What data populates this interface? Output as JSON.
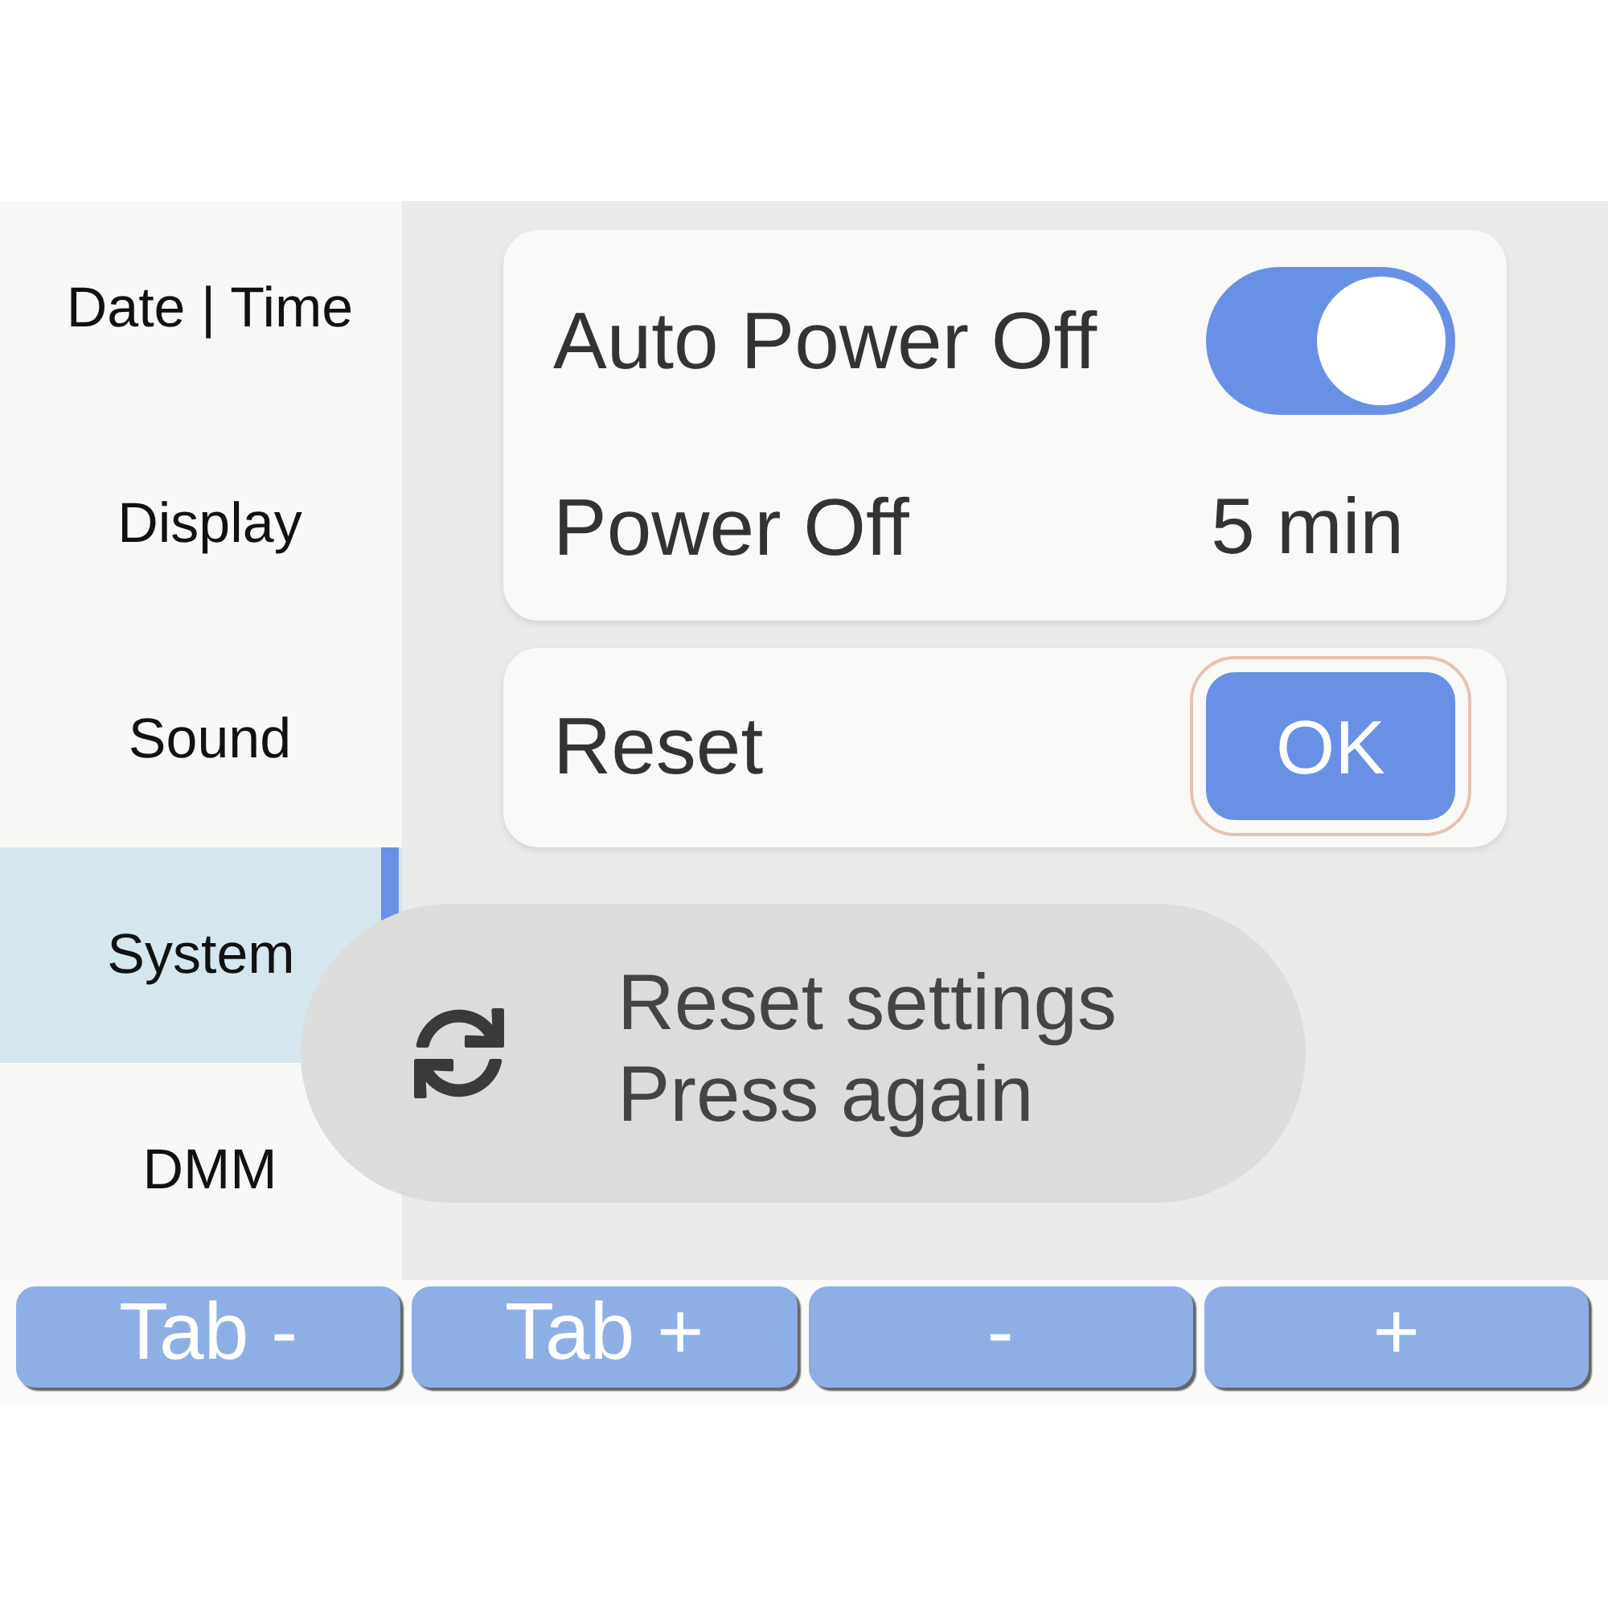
{
  "sidebar": {
    "items": [
      {
        "label": "Date | Time",
        "selected": false
      },
      {
        "label": "Display",
        "selected": false
      },
      {
        "label": "Sound",
        "selected": false
      },
      {
        "label": "System",
        "selected": true
      },
      {
        "label": "DMM",
        "selected": false
      }
    ]
  },
  "settings": {
    "cards": [
      {
        "rows": [
          {
            "kind": "toggle",
            "label": "Auto Power Off",
            "on": true
          },
          {
            "kind": "value",
            "label": "Power Off",
            "value": "5 min"
          }
        ]
      },
      {
        "rows": [
          {
            "kind": "button",
            "label": "Reset",
            "button": {
              "label": "OK",
              "focused": true
            }
          }
        ]
      }
    ]
  },
  "toast": {
    "lines": [
      "Reset settings",
      "Press again"
    ]
  },
  "soft_keys": [
    {
      "label": "Tab -"
    },
    {
      "label": "Tab +"
    },
    {
      "label": "-"
    },
    {
      "label": "+"
    }
  ]
}
